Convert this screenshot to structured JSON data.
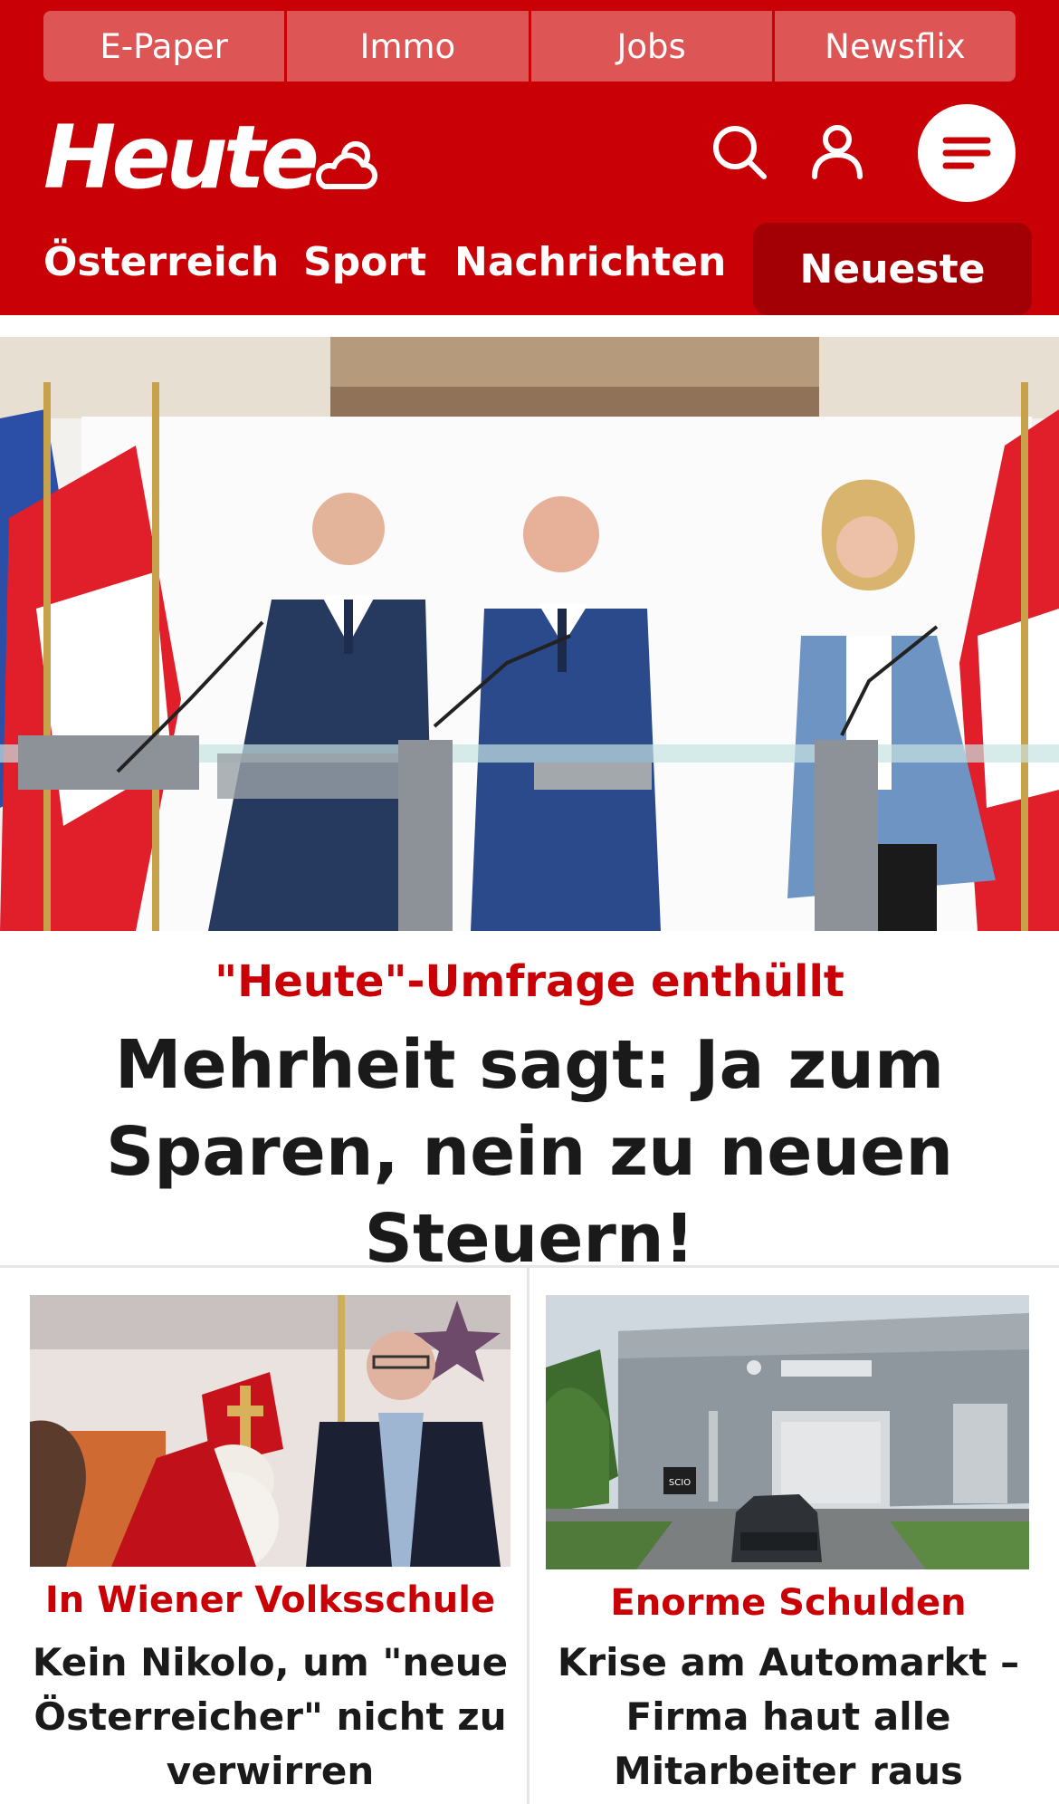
{
  "topbar": {
    "links": [
      "E-Paper",
      "Immo",
      "Jobs",
      "Newsflix"
    ]
  },
  "brand": {
    "logo_text": "Heute",
    "color": "#c90005",
    "dark_color": "#a20004"
  },
  "header": {
    "icons": [
      "weather-icon",
      "search-icon",
      "user-icon",
      "menu-icon"
    ]
  },
  "nav": {
    "items": [
      "Österreich",
      "Sport",
      "Nachrichten"
    ],
    "highlight": "Neueste"
  },
  "hero": {
    "kicker": "\"Heute\"-Umfrage enthüllt",
    "title": "Mehrheit sagt: Ja zum Sparen, nein zu neuen Steuern!"
  },
  "teasers": [
    {
      "kicker": "In Wiener Volksschule",
      "title": "Kein Nikolo, um \"neue Österreicher\" nicht zu verwirren"
    },
    {
      "kicker": "Enorme Schulden",
      "title": "Krise am Automarkt – Firma haut alle Mitarbeiter raus"
    }
  ],
  "teaser_image_labels": {
    "building_sign": "SCIO"
  }
}
